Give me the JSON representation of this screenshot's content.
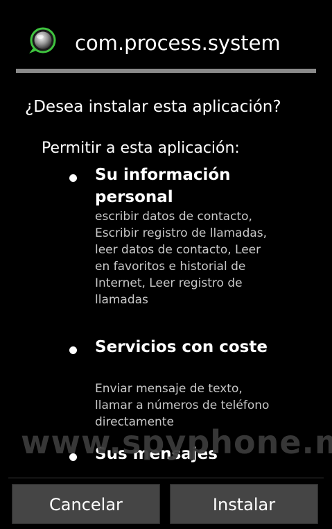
{
  "header": {
    "app_name": "com.process.system",
    "icon": "app-icon-green-ring"
  },
  "question": "¿Desea instalar esta aplicación?",
  "allow_label": "Permitir a esta aplicación:",
  "permissions": [
    {
      "title": "Su información personal",
      "description": "escribir datos de contacto, Escribir registro de llamadas, leer datos de contacto, Leer en favoritos e historial de Internet, Leer registro de llamadas"
    },
    {
      "title": "Servicios con coste",
      "description": "Enviar mensaje de texto, llamar a números de teléfono directamente"
    },
    {
      "title": "Sus mensajes",
      "description": ""
    }
  ],
  "watermark": "www.spyphone.me",
  "buttons": {
    "cancel": "Cancelar",
    "install": "Instalar"
  },
  "colors": {
    "background": "#000000",
    "divider": "#8a8a8a",
    "button_bg": "#454545",
    "icon_ring": "#3fc43f"
  }
}
